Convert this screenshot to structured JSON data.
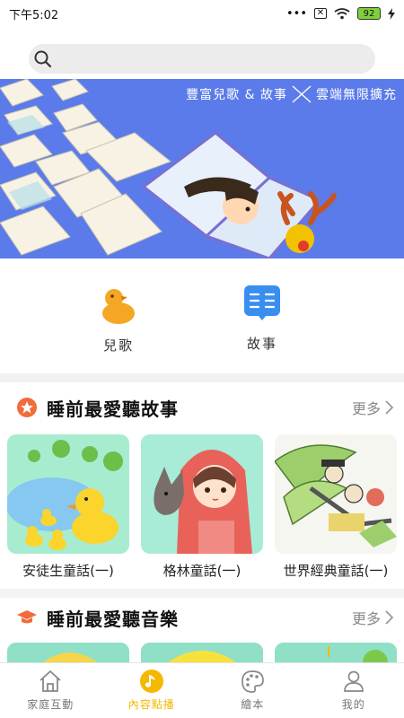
{
  "status_bar": {
    "time": "下午5:02",
    "dots": "•••",
    "battery": "92"
  },
  "search": {
    "placeholder": ""
  },
  "banner": {
    "caption_left": "豐富兒歌 & 故事",
    "caption_right": "雲端無限擴充"
  },
  "categories": [
    {
      "label": "兒歌",
      "icon": "duck-icon"
    },
    {
      "label": "故事",
      "icon": "book-icon"
    }
  ],
  "sections": [
    {
      "title": "睡前最愛聽故事",
      "more": "更多",
      "icon": "story-badge-icon",
      "cards": [
        {
          "label": "安徒生童話(一)"
        },
        {
          "label": "格林童話(一)"
        },
        {
          "label": "世界經典童話(一)"
        }
      ]
    },
    {
      "title": "睡前最愛聽音樂",
      "more": "更多",
      "icon": "graduation-cap-icon"
    }
  ],
  "bottom_nav": [
    {
      "label": "家庭互動",
      "icon": "home-icon",
      "active": false
    },
    {
      "label": "內容點播",
      "icon": "music-note-icon",
      "active": true
    },
    {
      "label": "繪本",
      "icon": "palette-icon",
      "active": false
    },
    {
      "label": "我的",
      "icon": "person-icon",
      "active": false
    }
  ],
  "colors": {
    "accent": "#f5b800",
    "banner_bg": "#5b7bea",
    "section_icon": "#f26b3a"
  }
}
